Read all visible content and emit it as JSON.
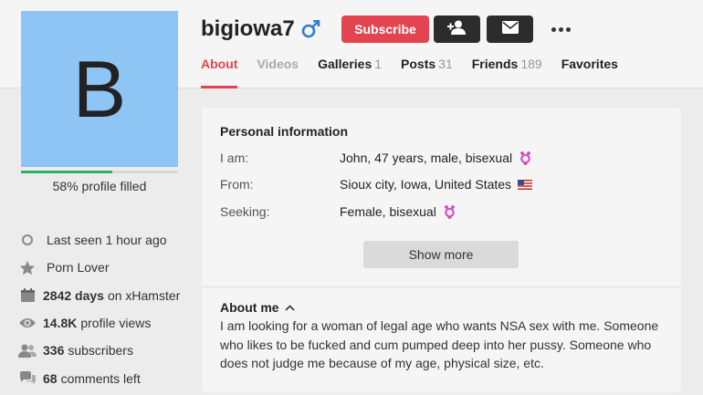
{
  "profile": {
    "avatar_letter": "B",
    "username": "bigiowa7",
    "completion_text": "58% profile filled",
    "completion_fraction": 0.58
  },
  "actions": {
    "subscribe_label": "Subscribe",
    "add_friend_icon": "add-friend-icon",
    "message_icon": "envelope-icon",
    "more_icon": "more-dots-icon"
  },
  "tabs": [
    {
      "label": "About",
      "count": ""
    },
    {
      "label": "Videos",
      "count": ""
    },
    {
      "label": "Galleries",
      "count": "1"
    },
    {
      "label": "Posts",
      "count": "31"
    },
    {
      "label": "Friends",
      "count": "189"
    },
    {
      "label": "Favorites",
      "count": ""
    }
  ],
  "stats": [
    {
      "icon": "clock-icon",
      "bold": "",
      "text": "Last seen 1 hour ago"
    },
    {
      "icon": "star-icon",
      "bold": "",
      "text": "Porn Lover"
    },
    {
      "icon": "calendar-icon",
      "bold": "2842 days",
      "text": "on xHamster"
    },
    {
      "icon": "eye-icon",
      "bold": "14.8K",
      "text": "profile views"
    },
    {
      "icon": "users-icon",
      "bold": "336",
      "text": "subscribers"
    },
    {
      "icon": "comments-icon",
      "bold": "68",
      "text": "comments left"
    }
  ],
  "personal_info": {
    "title": "Personal information",
    "rows": [
      {
        "label": "I am:",
        "value": "John, 47 years, male, bisexual",
        "icon": "bisexual-icon"
      },
      {
        "label": "From:",
        "value": "Sioux city, Iowa, United States",
        "icon": "us-flag-icon"
      },
      {
        "label": "Seeking:",
        "value": "Female, bisexual",
        "icon": "bisexual-icon"
      }
    ],
    "show_more_label": "Show more"
  },
  "about": {
    "title": "About me",
    "text": "I am looking for a woman of legal age who wants NSA sex with me. Someone who likes to be fucked and cum pumped deep into her pussy. Someone who does not judge me because of my age, physical size, etc."
  },
  "colors": {
    "accent": "#e34450",
    "male_icon": "#2d7fd1",
    "bisexual_icon": "#d94fc4",
    "progress": "#2db06c",
    "avatar_bg": "#8ec5f5"
  }
}
